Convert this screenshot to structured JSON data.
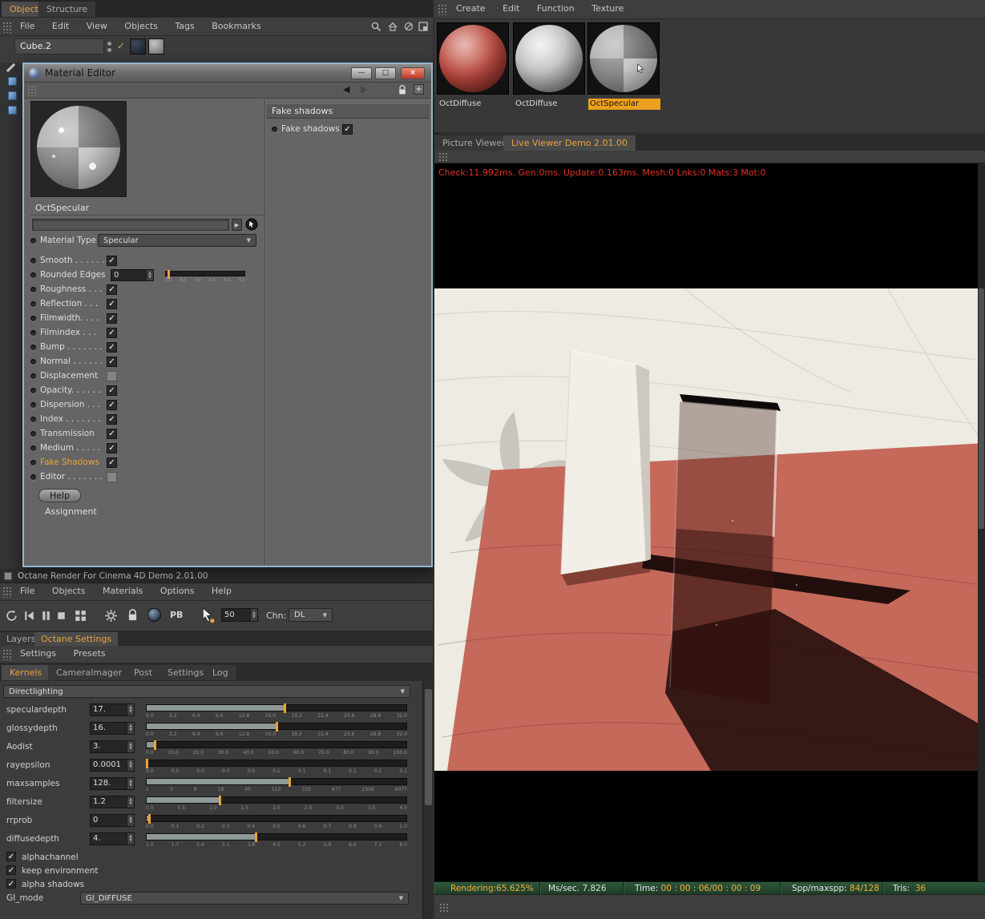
{
  "object_manager": {
    "tabs": [
      {
        "label": "Objects",
        "active": true
      },
      {
        "label": "Structure",
        "active": false
      }
    ],
    "menu": [
      "File",
      "Edit",
      "View",
      "Objects",
      "Tags",
      "Bookmarks"
    ],
    "object_name": "Cube.2"
  },
  "material_editor": {
    "title": "Material Editor",
    "material_name": "OctSpecular",
    "material_type_label": "Material Type",
    "material_type_value": "Specular",
    "params": [
      {
        "label": "Smooth . . . . . .",
        "checked": true
      },
      {
        "label": "Rounded Edges",
        "type": "spinner",
        "value": "0",
        "ticks": [
          "0.0",
          "0.0",
          "0.0",
          "0.1",
          "0.1",
          "0.1"
        ]
      },
      {
        "label": "Roughness . . .",
        "checked": true
      },
      {
        "label": "Reflection . . .",
        "checked": true
      },
      {
        "label": "Filmwidth. . . .",
        "checked": true
      },
      {
        "label": "Filmindex . . .",
        "checked": true
      },
      {
        "label": "Bump . . . . . . .",
        "checked": true
      },
      {
        "label": "Normal . . . . . .",
        "checked": true
      },
      {
        "label": "Displacement",
        "checked": false
      },
      {
        "label": "Opacity. . . . . .",
        "checked": true
      },
      {
        "label": "Dispersion . . .",
        "checked": true
      },
      {
        "label": "Index . . . . . . .",
        "checked": true
      },
      {
        "label": "Transmission",
        "checked": true
      },
      {
        "label": "Medium . . . . .",
        "checked": true
      },
      {
        "label": "Fake Shadows",
        "checked": true,
        "highlight": true
      },
      {
        "label": "Editor . . . . . . .",
        "checked": false
      }
    ],
    "help_label": "Help",
    "assignment_label": "Assignment",
    "fake_shadows_header": "Fake shadows",
    "fake_shadows_item": "Fake shadows"
  },
  "octane_window": {
    "title": "Octane Render For Cinema 4D Demo 2.01.00",
    "menu": [
      "File",
      "Objects",
      "Materials",
      "Options",
      "Help"
    ],
    "toolbar": {
      "samples_value": "50",
      "channel_label": "Chn:",
      "channel_value": "DL",
      "pb_label": "PB"
    },
    "main_tabs": [
      {
        "label": "Layers",
        "active": false
      },
      {
        "label": "Octane Settings",
        "active": true
      }
    ],
    "sub_tabs": [
      "Settings",
      "Presets"
    ],
    "kernel_tabs": [
      {
        "label": "Kernels",
        "active": true
      },
      {
        "label": "CameraImager",
        "active": false
      },
      {
        "label": "Post",
        "active": false
      },
      {
        "label": "Settings",
        "active": false
      },
      {
        "label": "Log",
        "active": false
      }
    ],
    "kernel_type": "Directlighting",
    "params": [
      {
        "label": "speculardepth",
        "value": "17.",
        "pct": 53,
        "ticks": [
          "0.0",
          "3.2",
          "6.4",
          "9.6",
          "12.8",
          "16.0",
          "19.2",
          "22.4",
          "25.6",
          "28.8",
          "32.0"
        ]
      },
      {
        "label": "glossydepth",
        "value": "16.",
        "pct": 50,
        "ticks": [
          "0.0",
          "3.2",
          "6.4",
          "9.6",
          "12.8",
          "16.0",
          "19.2",
          "22.4",
          "25.6",
          "28.8",
          "32.0"
        ]
      },
      {
        "label": "Aodist",
        "value": "3.",
        "pct": 3,
        "ticks": [
          "0.0",
          "10.0",
          "20.0",
          "30.0",
          "40.0",
          "50.0",
          "60.0",
          "70.0",
          "80.0",
          "90.0",
          "100.0"
        ]
      },
      {
        "label": "rayepsilon",
        "value": "0.0001",
        "pct": 0,
        "ticks": [
          "0.0",
          "0.0",
          "0.0",
          "0.0",
          "0.0",
          "0.1",
          "0.1",
          "0.1",
          "0.1",
          "0.1",
          "0.1"
        ]
      },
      {
        "label": "maxsamples",
        "value": "128.",
        "pct": 55,
        "ticks": [
          "1",
          "3",
          "9",
          "18",
          "45",
          "113",
          "333",
          "677",
          "2308",
          "6077"
        ]
      },
      {
        "label": "filtersize",
        "value": "1.2",
        "pct": 28,
        "ticks": [
          "0.0",
          "0.5",
          "1.0",
          "1.5",
          "2.0",
          "2.5",
          "3.0",
          "3.5",
          "4.0"
        ]
      },
      {
        "label": "rrprob",
        "value": "0",
        "pct": 1,
        "ticks": [
          "0.0",
          "0.1",
          "0.2",
          "0.3",
          "0.4",
          "0.5",
          "0.6",
          "0.7",
          "0.8",
          "0.9",
          "1.0"
        ]
      },
      {
        "label": "diffusedepth",
        "value": "4.",
        "pct": 42,
        "ticks": [
          "1.0",
          "1.7",
          "2.4",
          "3.1",
          "3.8",
          "4.5",
          "5.2",
          "5.9",
          "6.6",
          "7.3",
          "8.0"
        ]
      }
    ],
    "checkboxes": [
      "alphachannel",
      "keep environment",
      "alpha shadows"
    ],
    "gi_mode_label": "GI_mode",
    "gi_mode_value": "GI_DIFFUSE"
  },
  "materials_panel": {
    "menu": [
      "Create",
      "Edit",
      "Function",
      "Texture"
    ],
    "items": [
      {
        "name": "OctDiffuse",
        "selected": false
      },
      {
        "name": "OctDiffuse",
        "selected": false
      },
      {
        "name": "OctSpecular",
        "selected": true
      }
    ]
  },
  "viewer": {
    "tabs": [
      {
        "label": "Picture Viewer",
        "active": false
      },
      {
        "label": "Live Viewer Demo 2.01.00",
        "active": true
      }
    ],
    "status_line": "Check:11.992ms. Gen:0ms. Update:0.163ms. Mesh:0 Lnks:0 Mats:3 Mot:0",
    "footer": {
      "rendering_label": "Rendering:",
      "rendering_value": "65.625%",
      "ms_label": "Ms/sec.",
      "ms_value": "7.826",
      "time_label": "Time:",
      "time_value": "00 : 00 : 06/00 : 00 : 09",
      "spp_label": "Spp/maxspp:",
      "spp_value": "84/128",
      "tris_label": "Tris:",
      "tris_value": "36"
    }
  },
  "colors": {
    "accent": "#e8a33c",
    "status_red": "#e03322",
    "floor_red": "#c5695b"
  }
}
